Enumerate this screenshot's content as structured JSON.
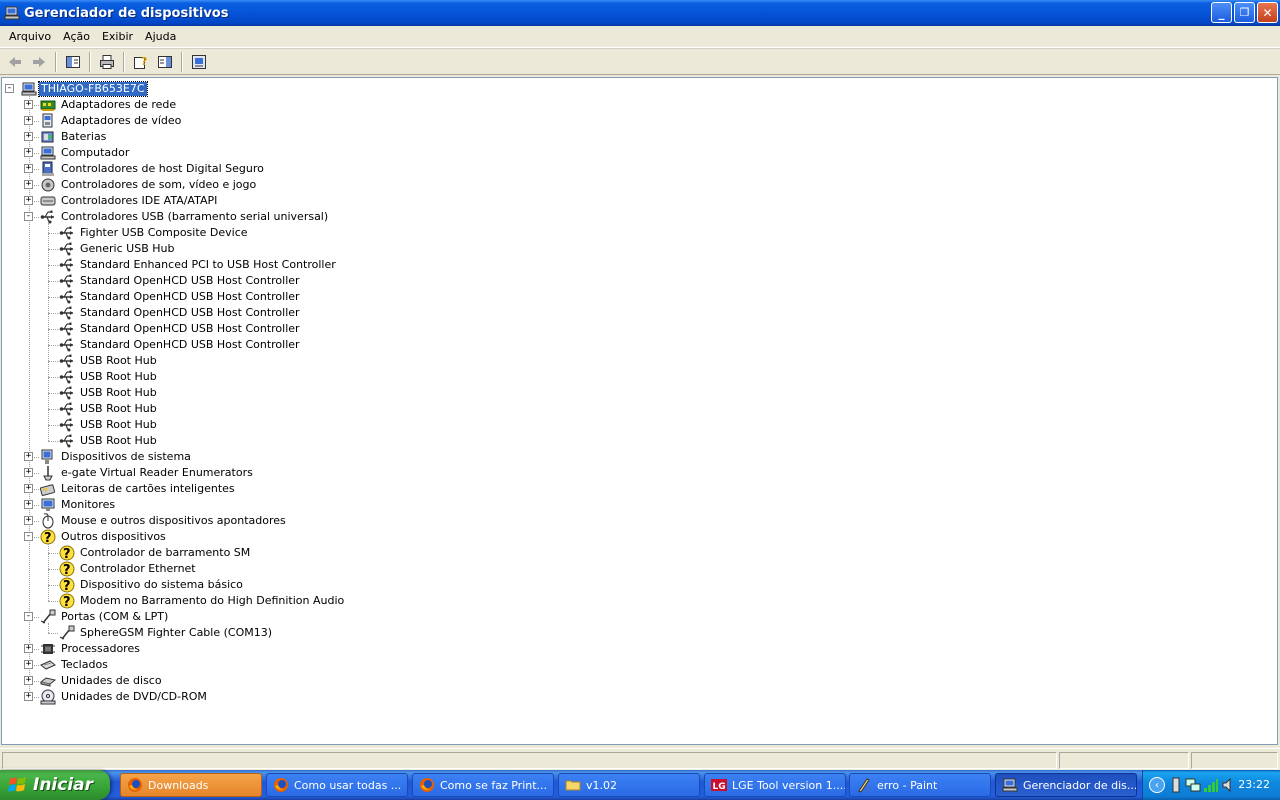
{
  "window": {
    "title": "Gerenciador de dispositivos",
    "minimize_glyph": "_",
    "maximize_glyph": "❐",
    "close_glyph": "✕"
  },
  "menu": {
    "items": [
      "Arquivo",
      "Ação",
      "Exibir",
      "Ajuda"
    ]
  },
  "toolbar": {
    "buttons": [
      "back-arrow-icon",
      "forward-arrow-icon",
      "show-hide-tree-icon",
      "print-icon",
      "help-properties-icon",
      "properties-pane-icon",
      "scan-hardware-icon"
    ]
  },
  "tree": {
    "root": "THIAGO-FB653E7C",
    "nodes": [
      {
        "label": "Adaptadores de rede",
        "level": 1,
        "expander": "+",
        "icon": "network-adapter-icon"
      },
      {
        "label": "Adaptadores de vídeo",
        "level": 1,
        "expander": "+",
        "icon": "display-adapter-icon"
      },
      {
        "label": "Baterias",
        "level": 1,
        "expander": "+",
        "icon": "battery-icon"
      },
      {
        "label": "Computador",
        "level": 1,
        "expander": "+",
        "icon": "computer-icon"
      },
      {
        "label": "Controladores de host Digital Seguro",
        "level": 1,
        "expander": "+",
        "icon": "sd-host-icon"
      },
      {
        "label": "Controladores de som, vídeo e jogo",
        "level": 1,
        "expander": "+",
        "icon": "sound-icon"
      },
      {
        "label": "Controladores IDE ATA/ATAPI",
        "level": 1,
        "expander": "+",
        "icon": "ide-icon"
      },
      {
        "label": "Controladores USB (barramento serial universal)",
        "level": 1,
        "expander": "-",
        "icon": "usb-icon"
      },
      {
        "label": "Fighter USB Composite Device",
        "level": 2,
        "icon": "usb-icon"
      },
      {
        "label": "Generic USB Hub",
        "level": 2,
        "icon": "usb-icon"
      },
      {
        "label": "Standard Enhanced PCI to USB Host Controller",
        "level": 2,
        "icon": "usb-icon"
      },
      {
        "label": "Standard OpenHCD USB Host Controller",
        "level": 2,
        "icon": "usb-icon"
      },
      {
        "label": "Standard OpenHCD USB Host Controller",
        "level": 2,
        "icon": "usb-icon"
      },
      {
        "label": "Standard OpenHCD USB Host Controller",
        "level": 2,
        "icon": "usb-icon"
      },
      {
        "label": "Standard OpenHCD USB Host Controller",
        "level": 2,
        "icon": "usb-icon"
      },
      {
        "label": "Standard OpenHCD USB Host Controller",
        "level": 2,
        "icon": "usb-icon"
      },
      {
        "label": "USB Root Hub",
        "level": 2,
        "icon": "usb-icon"
      },
      {
        "label": "USB Root Hub",
        "level": 2,
        "icon": "usb-icon"
      },
      {
        "label": "USB Root Hub",
        "level": 2,
        "icon": "usb-icon"
      },
      {
        "label": "USB Root Hub",
        "level": 2,
        "icon": "usb-icon"
      },
      {
        "label": "USB Root Hub",
        "level": 2,
        "icon": "usb-icon"
      },
      {
        "label": "USB Root Hub",
        "level": 2,
        "icon": "usb-icon"
      },
      {
        "label": "Dispositivos de sistema",
        "level": 1,
        "expander": "+",
        "icon": "system-device-icon"
      },
      {
        "label": "e-gate Virtual Reader Enumerators",
        "level": 1,
        "expander": "+",
        "icon": "reader-icon"
      },
      {
        "label": "Leitoras de cartões inteligentes",
        "level": 1,
        "expander": "+",
        "icon": "smartcard-icon"
      },
      {
        "label": "Monitores",
        "level": 1,
        "expander": "+",
        "icon": "monitor-icon"
      },
      {
        "label": "Mouse e outros dispositivos apontadores",
        "level": 1,
        "expander": "+",
        "icon": "mouse-icon"
      },
      {
        "label": "Outros dispositivos",
        "level": 1,
        "expander": "-",
        "icon": "unknown-device-icon"
      },
      {
        "label": "Controlador de barramento SM",
        "level": 2,
        "icon": "unknown-device-icon"
      },
      {
        "label": "Controlador Ethernet",
        "level": 2,
        "icon": "unknown-device-icon"
      },
      {
        "label": "Dispositivo do sistema básico",
        "level": 2,
        "icon": "unknown-device-icon"
      },
      {
        "label": "Modem no Barramento do High Definition Audio",
        "level": 2,
        "icon": "unknown-device-icon"
      },
      {
        "label": "Portas (COM & LPT)",
        "level": 1,
        "expander": "-",
        "icon": "port-icon"
      },
      {
        "label": "SphereGSM Fighter Cable (COM13)",
        "level": 2,
        "icon": "port-icon"
      },
      {
        "label": "Processadores",
        "level": 1,
        "expander": "+",
        "icon": "processor-icon"
      },
      {
        "label": "Teclados",
        "level": 1,
        "expander": "+",
        "icon": "keyboard-icon"
      },
      {
        "label": "Unidades de disco",
        "level": 1,
        "expander": "+",
        "icon": "disk-icon"
      },
      {
        "label": "Unidades de DVD/CD-ROM",
        "level": 1,
        "expander": "+",
        "icon": "dvd-icon"
      }
    ]
  },
  "taskbar": {
    "start_label": "Iniciar",
    "tasks": [
      {
        "label": "Downloads",
        "icon": "firefox-icon",
        "state": "flash"
      },
      {
        "label": "Como usar todas ...",
        "icon": "firefox-icon",
        "state": "normal"
      },
      {
        "label": "Como se faz Print...",
        "icon": "firefox-icon",
        "state": "normal"
      },
      {
        "label": "v1.02",
        "icon": "folder-icon",
        "state": "normal"
      },
      {
        "label": "LGE Tool version 1....",
        "icon": "lg-icon",
        "state": "normal"
      },
      {
        "label": "erro - Paint",
        "icon": "paint-icon",
        "state": "normal"
      },
      {
        "label": "Gerenciador de dis...",
        "icon": "device-manager-icon",
        "state": "active"
      }
    ],
    "clock": "23:22"
  },
  "colors": {
    "selection": "#316ac5",
    "titlebar": "#0554d8",
    "taskbar": "#245edb",
    "start": "#36a336"
  }
}
